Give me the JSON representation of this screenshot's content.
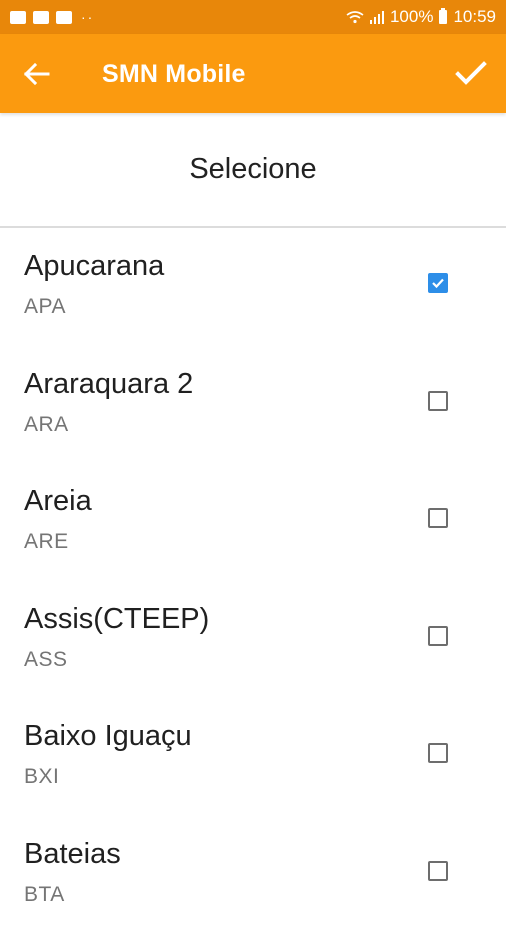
{
  "status_bar": {
    "battery": "100%",
    "time": "10:59"
  },
  "app_bar": {
    "title": "SMN Mobile"
  },
  "header": {
    "title": "Selecione"
  },
  "items": [
    {
      "name": "Apucarana",
      "code": "APA",
      "checked": true
    },
    {
      "name": "Araraquara 2",
      "code": "ARA",
      "checked": false
    },
    {
      "name": "Areia",
      "code": "ARE",
      "checked": false
    },
    {
      "name": "Assis(CTEEP)",
      "code": "ASS",
      "checked": false
    },
    {
      "name": "Baixo Iguaçu",
      "code": "BXI",
      "checked": false
    },
    {
      "name": "Bateias",
      "code": "BTA",
      "checked": false
    }
  ],
  "colors": {
    "status_bar": "#e8870a",
    "app_bar": "#fb9a0f",
    "checkbox_checked": "#2d8ee8"
  }
}
